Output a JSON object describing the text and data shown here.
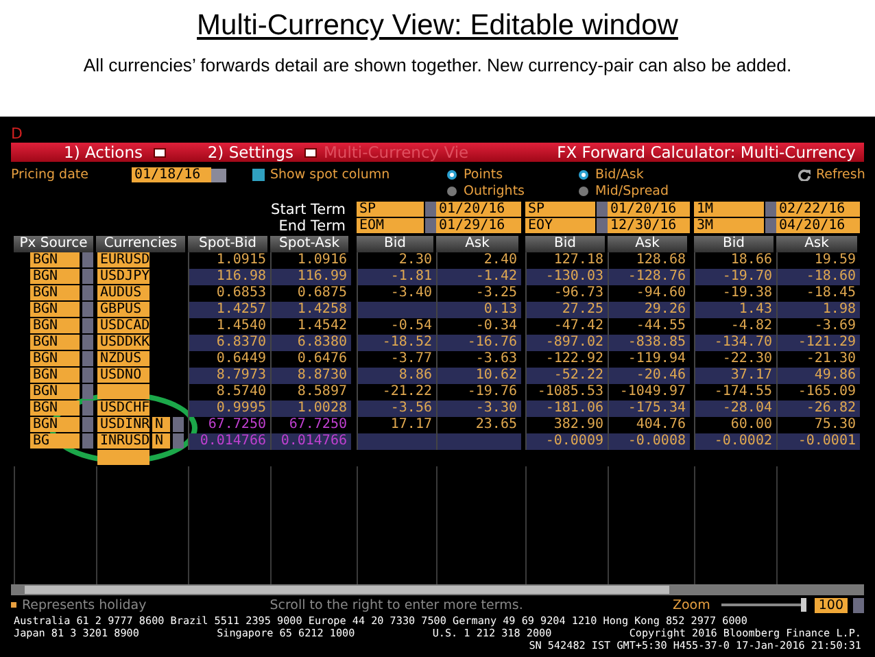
{
  "slide": {
    "title": "Multi-Currency View: Editable window",
    "subtitle": "All currencies’ forwards detail are shown together. New currency-pair can also be added."
  },
  "terminal": {
    "code": "D",
    "menu": [
      {
        "kind": "menu",
        "label": "1) Actions"
      },
      {
        "kind": "menu",
        "label": "2) Settings"
      },
      {
        "kind": "faded",
        "label": "Multi-Currency Vie"
      }
    ],
    "window_title": "FX Forward Calculator: Multi-Currency",
    "pricing_date": {
      "label": "Pricing date",
      "value": "01/18/16"
    },
    "show_spot": {
      "label": "Show spot column",
      "checked": true
    },
    "radio_groups": [
      [
        {
          "label": "Points",
          "selected": true
        },
        {
          "label": "Outrights",
          "selected": false
        }
      ],
      [
        {
          "label": "Bid/Ask",
          "selected": true
        },
        {
          "label": "Mid/Spread",
          "selected": false
        }
      ]
    ],
    "refresh": "Refresh",
    "start_term_label": "Start Term",
    "end_term_label": "End Term",
    "columns": [
      "Px Source",
      "Currencies",
      "Spot-Bid",
      "Spot-Ask"
    ],
    "term_groups": [
      {
        "start_term": "SP",
        "start_date": "01/20/16",
        "end_term": "EOM",
        "end_date": "01/29/16",
        "columns": [
          "Bid",
          "Ask"
        ]
      },
      {
        "start_term": "SP",
        "start_date": "01/20/16",
        "end_term": "EOY",
        "end_date": "12/30/16",
        "columns": [
          "Bid",
          "Ask"
        ]
      },
      {
        "start_term": "1M",
        "start_date": "02/22/16",
        "end_term": "3M",
        "end_date": "04/20/16",
        "columns": [
          "Bid",
          "Ask"
        ]
      }
    ],
    "rows": [
      {
        "source": "BGN",
        "currency": "EURUSD",
        "spot_bid": "1.0915",
        "spot_ask": "1.0916",
        "values": [
          "2.30",
          "2.40",
          "127.18",
          "128.68",
          "18.66",
          "19.59"
        ]
      },
      {
        "source": "BGN",
        "currency": "USDJPY",
        "spot_bid": "116.98",
        "spot_ask": "116.99",
        "values": [
          "-1.81",
          "-1.42",
          "-130.03",
          "-128.76",
          "-19.70",
          "-18.60"
        ]
      },
      {
        "source": "BGN",
        "currency": "AUDUS",
        "spot_bid": "0.6853",
        "spot_ask": "0.6875",
        "values": [
          "-3.40",
          "-3.25",
          "-96.73",
          "-94.60",
          "-19.38",
          "-18.45"
        ]
      },
      {
        "source": "BGN",
        "currency": "GBPUS",
        "spot_bid": "1.4257",
        "spot_ask": "1.4258",
        "term_1": {
          "ask": "0.13"
        },
        "term_2": {
          "bid": "27.25",
          "ask": "29.26"
        },
        "term_3": {
          "bid": "1.43",
          "ask": "1.98"
        }
      },
      {
        "source": "BGN",
        "currency": "USDCAD",
        "spot_bid": "1.4540",
        "spot_ask": "1.4542",
        "values": [
          "-0.54",
          "-0.34",
          "-47.42",
          "-44.55",
          "-4.82",
          "-3.69"
        ]
      },
      {
        "source": "BGN",
        "currency": "USDDKK",
        "spot_bid": "6.8370",
        "spot_ask": "6.8380",
        "values": [
          "-18.52",
          "-16.76",
          "-897.02",
          "-838.85",
          "-134.70",
          "-121.29"
        ]
      },
      {
        "source": "BGN",
        "currency": "NZDUS",
        "spot_bid": "0.6449",
        "spot_ask": "0.6476",
        "values": [
          "-3.77",
          "-3.63",
          "-122.92",
          "-119.94",
          "-22.30",
          "-21.30"
        ]
      },
      {
        "source": "BGN",
        "currency": "USDNO",
        "spot_bid": "8.7973",
        "spot_ask": "8.8730",
        "values": [
          "8.86",
          "10.62",
          "-52.22",
          "-20.46",
          "37.17",
          "49.86"
        ]
      },
      {
        "source": "BGN",
        "spot_bid": "8.5740",
        "spot_ask": "8.5897",
        "values": [
          "-21.22",
          "-19.76",
          "-1085.53",
          "-1049.97",
          "-174.55",
          "-165.09"
        ]
      },
      {
        "source": "BGN",
        "currency": "USDCHF",
        "spot_bid": "0.9995",
        "spot_ask": "1.0028",
        "values": [
          "-3.56",
          "-3.30",
          "-181.06",
          "-175.34",
          "-28.04",
          "-26.82"
        ]
      },
      {
        "source": "BGN",
        "currency": "USDINR",
        "mode": "N",
        "kind": "added",
        "spot_bid": "67.7250",
        "spot_ask": "67.7250",
        "values": [
          "17.17",
          "23.65",
          "382.90",
          "404.76",
          "60.00",
          "75.30"
        ]
      },
      {
        "source": "BG",
        "currency": "INRUSD",
        "mode": "N",
        "kind": "added",
        "spot_bid": "0.014766",
        "spot_ask": "0.014766",
        "term_2": {
          "bid": "-0.0009",
          "ask": "-0.0008"
        },
        "term_3": {
          "bid": "-0.0002",
          "ask": "-0.0001"
        }
      }
    ],
    "holiday_note": "Represents holiday",
    "scroll_hint": "Scroll to the right to enter more terms.",
    "zoom": {
      "label": "Zoom",
      "value": "100",
      "level": 1
    },
    "footer_lines": [
      [
        "Australia 61 2 9777 8600 Brazil 5511 2395 9000 Europe 44 20 7330 7500 Germany 49 69 9204 1210 Hong Kong 852 2977 6000"
      ],
      [
        "Japan 81 3 3201 8900",
        "Singapore 65 6212 1000",
        "U.S. 1 212 318 2000",
        "Copyright 2016 Bloomberg Finance L.P."
      ],
      [
        "SN 542482 IST  GMT+5:30 H455-37-0 17-Jan-2016 21:50:31"
      ]
    ]
  }
}
